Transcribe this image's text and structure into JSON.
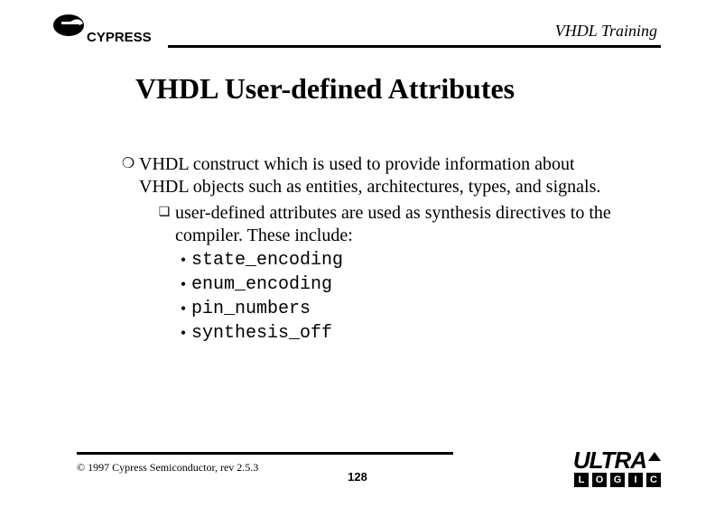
{
  "header": {
    "brand": "CYPRESS",
    "text": "VHDL Training"
  },
  "title": "VHDL User-defined Attributes",
  "bullets": {
    "lvl1_text": "VHDL construct which is used to provide information about VHDL objects such as entities, architectures, types, and signals.",
    "lvl2_text": "user-defined attributes are used as synthesis directives to the compiler. These include:",
    "items": [
      "state_encoding",
      "enum_encoding",
      "pin_numbers",
      "synthesis_off"
    ]
  },
  "footer": {
    "copyright": "© 1997 Cypress Semiconductor, rev 2.5.3",
    "page": "128",
    "logo_top": "ULTRA",
    "logo_letters": [
      "L",
      "O",
      "G",
      "I",
      "C"
    ]
  }
}
